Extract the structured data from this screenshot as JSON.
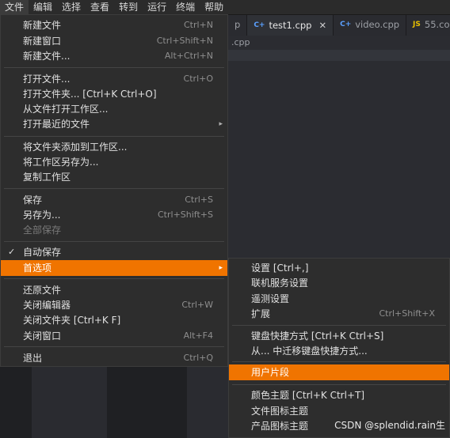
{
  "menubar": {
    "items": [
      "文件",
      "编辑",
      "选择",
      "查看",
      "转到",
      "运行",
      "终端",
      "帮助"
    ]
  },
  "tabs": [
    {
      "label": "p",
      "icon": ""
    },
    {
      "label": "test1.cpp",
      "icon": "C+",
      "close": "✕"
    },
    {
      "label": "video.cpp",
      "icon": "C+"
    },
    {
      "label": "55.co",
      "icon": "JS"
    }
  ],
  "breadcrumb": ".cpp",
  "file_menu": {
    "items": [
      {
        "label": "新建文件",
        "accel": "Ctrl+N"
      },
      {
        "label": "新建窗口",
        "accel": "Ctrl+Shift+N"
      },
      {
        "label": "新建文件...",
        "accel": "Alt+Ctrl+N"
      },
      {
        "label": "打开文件...",
        "accel": "Ctrl+O"
      },
      {
        "label": "打开文件夹... [Ctrl+K Ctrl+O]",
        "accel": ""
      },
      {
        "label": "从文件打开工作区...",
        "accel": ""
      },
      {
        "label": "打开最近的文件",
        "accel": "",
        "arrow": "▸"
      },
      {
        "label": "将文件夹添加到工作区...",
        "accel": ""
      },
      {
        "label": "将工作区另存为...",
        "accel": ""
      },
      {
        "label": "复制工作区",
        "accel": ""
      },
      {
        "label": "保存",
        "accel": "Ctrl+S"
      },
      {
        "label": "另存为...",
        "accel": "Ctrl+Shift+S"
      },
      {
        "label": "全部保存",
        "accel": ""
      },
      {
        "label": "自动保存",
        "accel": "",
        "check": "✓"
      },
      {
        "label": "首选项",
        "accel": "",
        "arrow": "▸"
      },
      {
        "label": "还原文件",
        "accel": ""
      },
      {
        "label": "关闭编辑器",
        "accel": "Ctrl+W"
      },
      {
        "label": "关闭文件夹 [Ctrl+K F]",
        "accel": ""
      },
      {
        "label": "关闭窗口",
        "accel": "Alt+F4"
      },
      {
        "label": "退出",
        "accel": "Ctrl+Q"
      }
    ]
  },
  "preferences_submenu": {
    "items": [
      {
        "label": "设置 [Ctrl+,]",
        "accel": ""
      },
      {
        "label": "联机服务设置",
        "accel": ""
      },
      {
        "label": "遥测设置",
        "accel": ""
      },
      {
        "label": "扩展",
        "accel": "Ctrl+Shift+X"
      },
      {
        "label": "键盘快捷方式 [Ctrl+K Ctrl+S]",
        "accel": ""
      },
      {
        "label": "从... 中迁移键盘快捷方式...",
        "accel": ""
      },
      {
        "label": "用户片段",
        "accel": ""
      },
      {
        "label": "颜色主题 [Ctrl+K Ctrl+T]",
        "accel": ""
      },
      {
        "label": "文件图标主题",
        "accel": ""
      },
      {
        "label": "产品图标主题",
        "accel": ""
      }
    ]
  },
  "watermark": "CSDN @splendid.rain生",
  "colors": {
    "highlight": "#f07400",
    "menu_bg": "#2d2d2d"
  }
}
